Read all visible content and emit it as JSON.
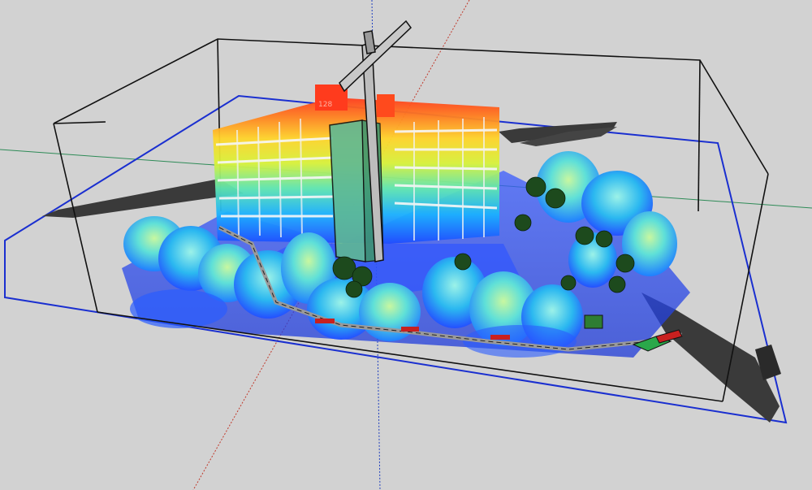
{
  "viewport": {
    "background": "#d2d2d2",
    "axis_colors": {
      "red": "#c0392b",
      "green": "#2e8b57",
      "blue": "#1f3fbf"
    },
    "bounding_box_color": "#111111",
    "ground_plane_color": "#1a2fd0"
  },
  "scene": {
    "marker_label": "128",
    "colormap": [
      "#ff3b1d",
      "#ff9a1f",
      "#ffee2a",
      "#a8f04a",
      "#3fe0c8",
      "#1aa8ff",
      "#1f4bff"
    ],
    "foliage_colors": [
      "#8ff0c0",
      "#2fc0f0",
      "#2a70ff",
      "#d6f06a"
    ],
    "road_color": "#3a3a3a",
    "tree_model_color": "#1d4a1d"
  }
}
